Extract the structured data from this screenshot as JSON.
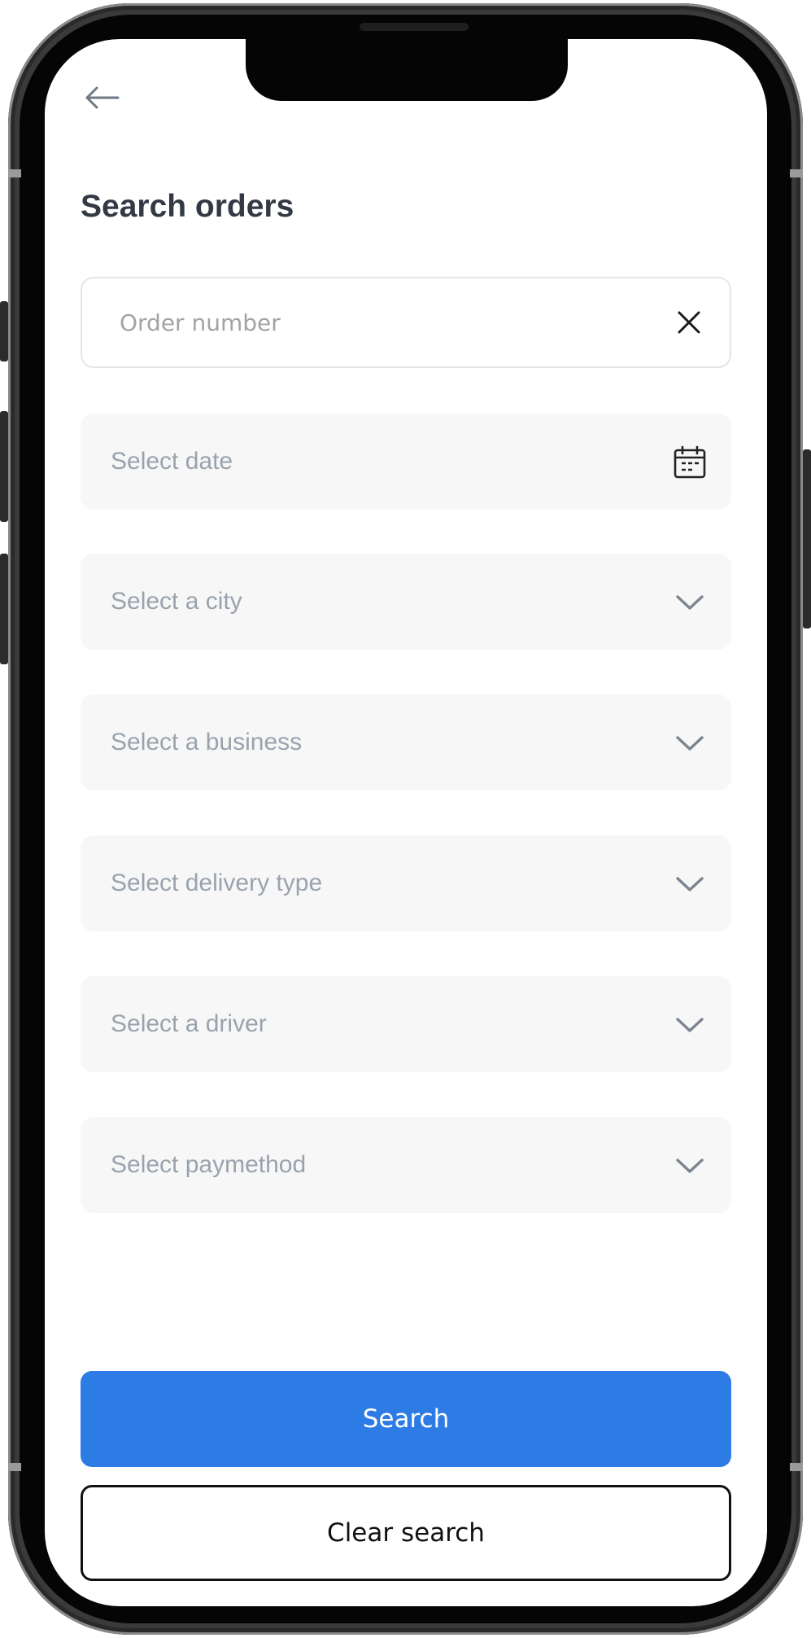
{
  "header": {
    "title": "Search orders",
    "back_icon": "arrow-left-icon"
  },
  "search": {
    "order_number_placeholder": "Order number",
    "order_number_value": "",
    "clear_icon": "close-icon"
  },
  "filters": {
    "date": {
      "label": "Select date",
      "icon": "calendar-icon"
    },
    "city": {
      "label": "Select a city",
      "icon": "chevron-down-icon"
    },
    "business": {
      "label": "Select a business",
      "icon": "chevron-down-icon"
    },
    "delivery_type": {
      "label": "Select delivery type",
      "icon": "chevron-down-icon"
    },
    "driver": {
      "label": "Select a driver",
      "icon": "chevron-down-icon"
    },
    "paymethod": {
      "label": "Select paymethod",
      "icon": "chevron-down-icon"
    }
  },
  "actions": {
    "search_label": "Search",
    "clear_label": "Clear search"
  },
  "colors": {
    "primary": "#2d7be4",
    "field_background": "#f7f7f7",
    "placeholder_text": "#9aa3ad",
    "title_text": "#333a45"
  }
}
